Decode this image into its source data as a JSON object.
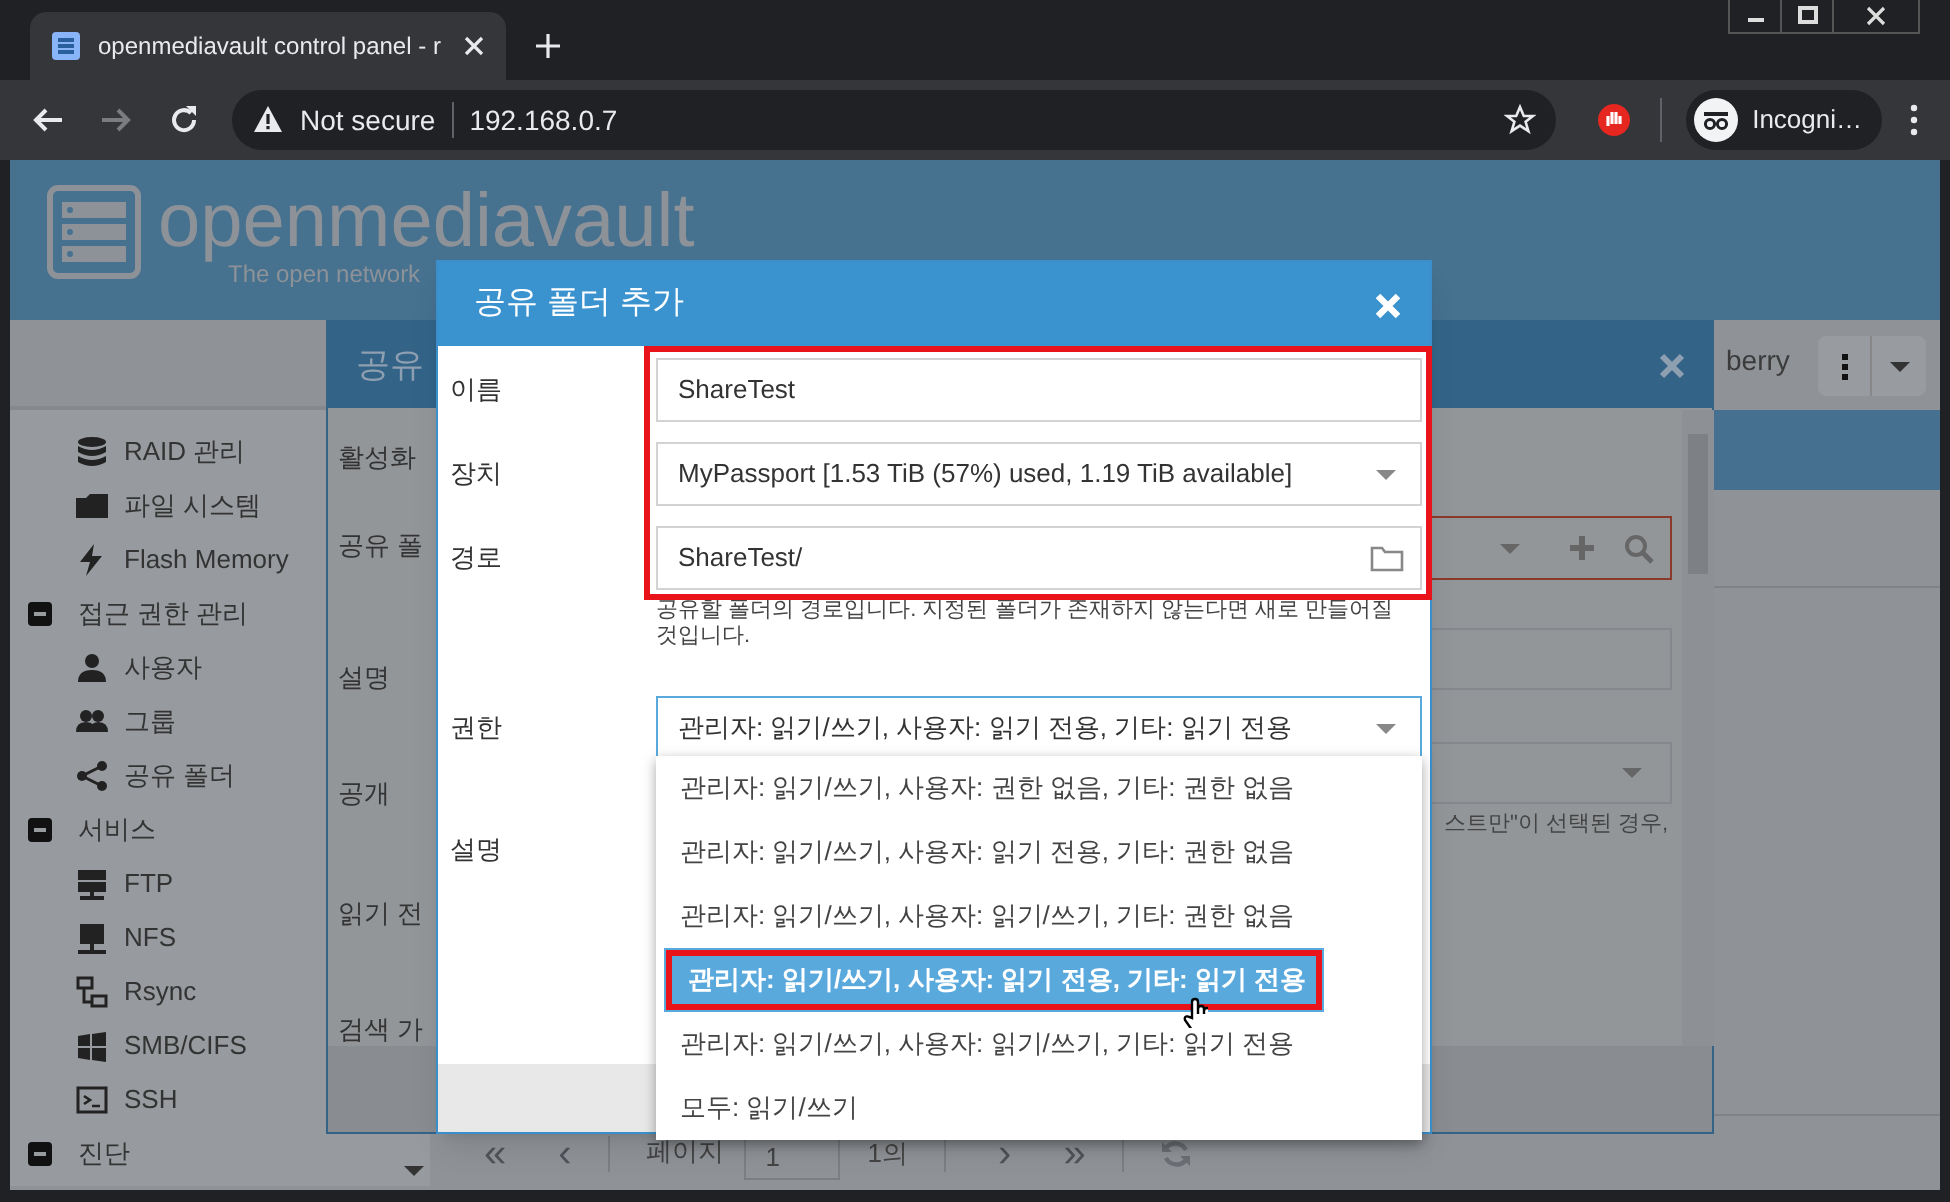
{
  "browser": {
    "tab": {
      "title": "openmediavault control panel - r",
      "selected": true
    },
    "security": "Not secure",
    "url": "192.168.0.7",
    "profile": "Incogni…"
  },
  "header": {
    "logo": "openmediavault",
    "tagline": "The open network"
  },
  "top_right": {
    "host": "berry"
  },
  "sidebar": {
    "groups": [
      {
        "expanded": true,
        "children": [
          {
            "label": "RAID 관리"
          },
          {
            "label": "파일 시스템"
          },
          {
            "label": "Flash Memory"
          }
        ]
      },
      {
        "label": "접근 권한 관리",
        "expanded": true,
        "children": [
          {
            "label": "사용자"
          },
          {
            "label": "그룹"
          },
          {
            "label": "공유 폴더"
          }
        ]
      },
      {
        "label": "서비스",
        "expanded": true,
        "children": [
          {
            "label": "FTP"
          },
          {
            "label": "NFS"
          },
          {
            "label": "Rsync"
          },
          {
            "label": "SMB/CIFS"
          },
          {
            "label": "SSH"
          }
        ]
      },
      {
        "label": "진단",
        "expanded": true
      }
    ]
  },
  "background_window": {
    "title": "공유",
    "labels": [
      "활성화",
      "공유 폴",
      "설명",
      "공개",
      "읽기 전",
      "검색 가"
    ],
    "hint": "스트만\"이 선택된 경우,"
  },
  "pager": {
    "first": "«",
    "previous": "‹",
    "page_label": "페이지",
    "page": "1",
    "of": "1의",
    "next": "›",
    "last": "»"
  },
  "dialog": {
    "title": "공유 폴더 추가",
    "fields_framed": true,
    "fields": [
      {
        "label": "이름",
        "kind": "text",
        "value": "ShareTest"
      },
      {
        "label": "장치",
        "kind": "select",
        "value": "MyPassport [1.53 TiB (57%) used, 1.19 TiB available]"
      },
      {
        "label": "경로",
        "kind": "folder",
        "value": "ShareTest/",
        "help": "공유할 폴더의 경로입니다. 지정된 폴더가 존재하지 않는다면 새로 만들어질 것입니다."
      },
      {
        "label": "권한",
        "kind": "select",
        "value": "관리자: 읽기/쓰기, 사용자: 읽기 전용, 기타: 읽기 전용",
        "expanded": true
      },
      {
        "label": "설명",
        "kind": "textarea"
      }
    ],
    "options": [
      {
        "label": "관리자: 읽기/쓰기, 사용자: 권한 없음, 기타: 권한 없음",
        "selected": false,
        "framed": false
      },
      {
        "label": "관리자: 읽기/쓰기, 사용자: 읽기 전용, 기타: 권한 없음",
        "selected": false,
        "framed": false
      },
      {
        "label": "관리자: 읽기/쓰기, 사용자: 읽기/쓰기, 기타: 권한 없음",
        "selected": false,
        "framed": false
      },
      {
        "label": "관리자: 읽기/쓰기, 사용자: 읽기 전용, 기타: 읽기 전용",
        "selected": true,
        "framed": true
      },
      {
        "label": "관리자: 읽기/쓰기, 사용자: 읽기/쓰기, 기타: 읽기 전용",
        "selected": false,
        "framed": false
      },
      {
        "label": "모두: 읽기/쓰기",
        "selected": false,
        "framed": false
      }
    ]
  }
}
